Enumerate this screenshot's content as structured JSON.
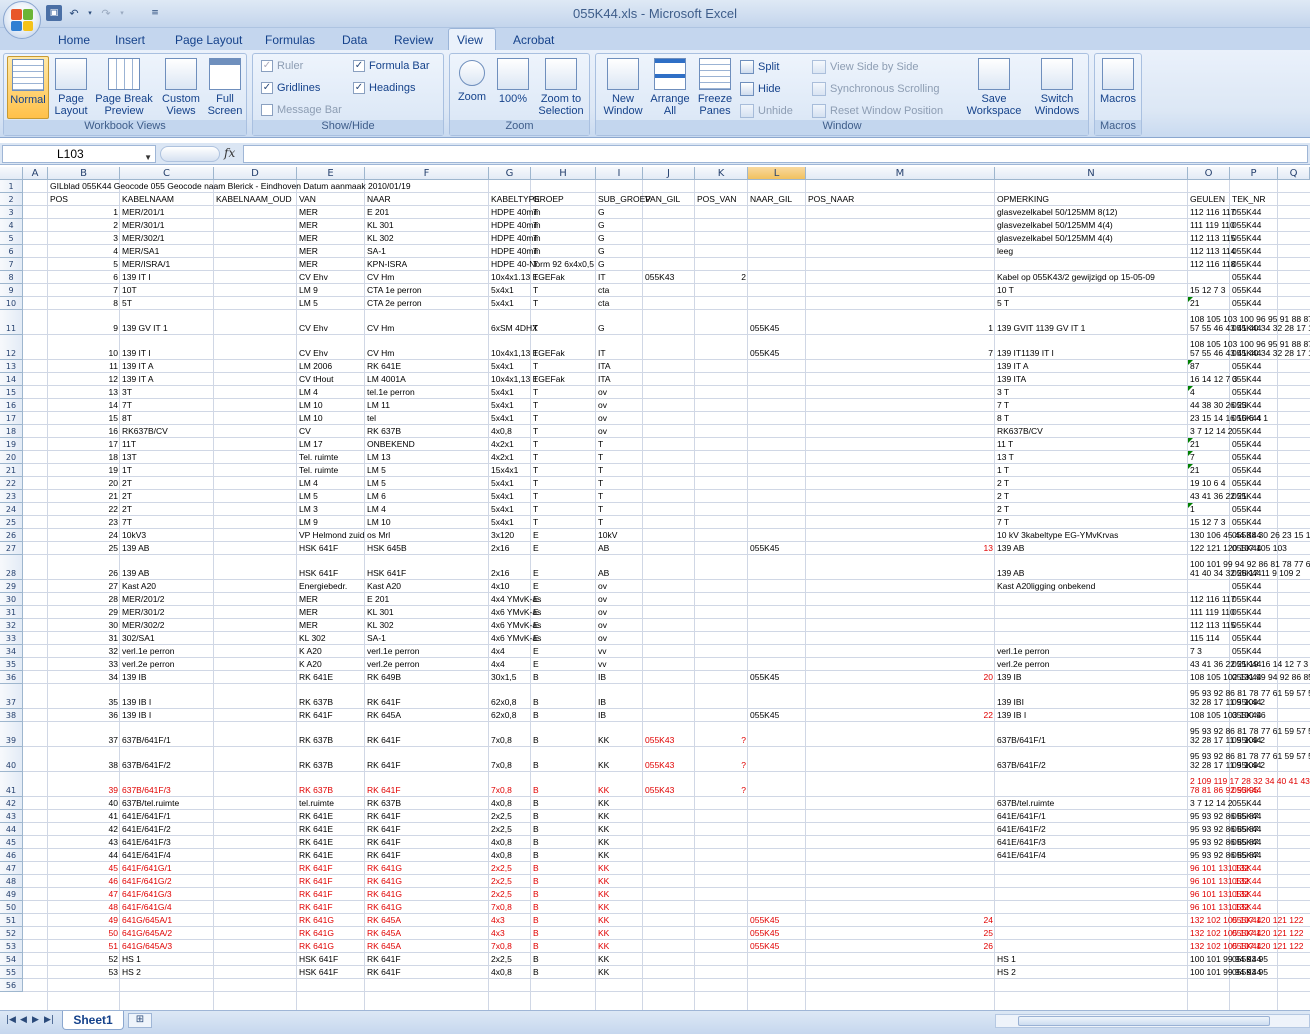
{
  "window": {
    "title": "055K44.xls - Microsoft Excel"
  },
  "qat": {
    "save": "💾",
    "undo": "↶",
    "redo": "↷"
  },
  "tabs": [
    "Home",
    "Insert",
    "Page Layout",
    "Formulas",
    "Data",
    "Review",
    "View",
    "Acrobat"
  ],
  "active_tab": "View",
  "ribbon": {
    "workbook_views": {
      "label": "Workbook Views",
      "normal": "Normal",
      "page_layout": "Page Layout",
      "page_break": "Page Break Preview",
      "custom": "Custom Views",
      "full": "Full Screen"
    },
    "show_hide": {
      "label": "Show/Hide",
      "ruler": "Ruler",
      "gridlines": "Gridlines",
      "message_bar": "Message Bar",
      "formula_bar": "Formula Bar",
      "headings": "Headings"
    },
    "zoom": {
      "label": "Zoom",
      "zoom": "Zoom",
      "hundred": "100%",
      "selection": "Zoom to Selection"
    },
    "window": {
      "label": "Window",
      "new_window": "New Window",
      "arrange": "Arrange All",
      "freeze": "Freeze Panes",
      "split": "Split",
      "hide": "Hide",
      "unhide": "Unhide",
      "side": "View Side by Side",
      "sync": "Synchronous Scrolling",
      "reset": "Reset Window Position",
      "save_ws": "Save Workspace",
      "switch": "Switch Windows"
    },
    "macros": {
      "label": "Macros",
      "macros": "Macros"
    }
  },
  "formula_bar": {
    "name_box": "L103",
    "fx": "fx",
    "value": ""
  },
  "columns": [
    "A",
    "B",
    "C",
    "D",
    "E",
    "F",
    "G",
    "H",
    "I",
    "J",
    "K",
    "L",
    "M",
    "N",
    "O",
    "P",
    "Q"
  ],
  "selected_column": "L",
  "row1": "GILblad 055K44 Geocode 055 Geocode naam Blerick - Eindhoven Datum aanmaak 2010/01/19",
  "headers": [
    "POS",
    "KABELNAAM",
    "KABELNAAM_OUD",
    "VAN",
    "NAAR",
    "KABELTYPE",
    "GROEP",
    "SUB_GROEP",
    "VAN_GIL",
    "POS_VAN",
    "NAAR_GIL",
    "POS_NAAR",
    "OPMERKING",
    "GEULEN",
    "TEK_NR"
  ],
  "rows": [
    {
      "n": 3,
      "c": [
        "1",
        "MER/201/1",
        "",
        "MER",
        "E 201",
        "HDPE 40mm",
        "T",
        "G",
        "",
        "",
        "",
        "",
        "glasvezelkabel 50/125MM 8(12)",
        "112 116 117",
        "055K44"
      ]
    },
    {
      "n": 4,
      "c": [
        "2",
        "MER/301/1",
        "",
        "MER",
        "KL 301",
        "HDPE 40mm",
        "T",
        "G",
        "",
        "",
        "",
        "",
        "glasvezelkabel 50/125MM 4(4)",
        "111 119 110",
        "055K44"
      ]
    },
    {
      "n": 5,
      "c": [
        "3",
        "MER/302/1",
        "",
        "MER",
        "KL 302",
        "HDPE 40mm",
        "T",
        "G",
        "",
        "",
        "",
        "",
        "glasvezelkabel 50/125MM 4(4)",
        "112 113 115",
        "055K44"
      ]
    },
    {
      "n": 6,
      "c": [
        "4",
        "MER/SA1",
        "",
        "MER",
        "SA-1",
        "HDPE 40mm",
        "T",
        "G",
        "",
        "",
        "",
        "",
        "leeg",
        "112 113 114",
        "055K44"
      ]
    },
    {
      "n": 7,
      "c": [
        "5",
        "MER/ISRA/1",
        "",
        "MER",
        "KPN-ISRA",
        "HDPE 40-Norm 92 6x4x0,5",
        "T",
        "G",
        "",
        "",
        "",
        "",
        "",
        "112 116 118",
        "055K44"
      ]
    },
    {
      "n": 8,
      "c": [
        "6",
        "139 IT I",
        "",
        "CV Ehv",
        "CV Hm",
        "10x4x1.13 EGEFak",
        "T",
        "IT",
        "055K43",
        "2",
        "",
        "",
        "Kabel op 055K43/2 gewijzigd op 15-05-09",
        "",
        "055K44"
      ]
    },
    {
      "n": 9,
      "c": [
        "7",
        "10T",
        "",
        "LM 9",
        "CTA 1e perron",
        "5x4x1",
        "T",
        "cta",
        "",
        "",
        "",
        "",
        "10 T",
        "15 12 7 3",
        "055K44"
      ]
    },
    {
      "n": 10,
      "c": [
        "8",
        "5T",
        "",
        "LM 5",
        "CTA 2e perron",
        "5x4x1",
        "T",
        "cta",
        "",
        "",
        "",
        "",
        "5 T",
        "21",
        "055K44"
      ]
    },
    {
      "n": 11,
      "c": [
        "9",
        "139 GV IT 1",
        "",
        "CV Ehv",
        "CV Hm",
        "6xSM 4DHX",
        "T",
        "G",
        "",
        "",
        "055K45",
        "1",
        "139 GVIT 1139 GV IT 1",
        "108 105 103 100 96 95 91 88 87 83 80 78 77 61 59|57 55 46 43 41 40 34 32 28 17 11 9 109 2",
        "055K44"
      ]
    },
    {
      "n": 12,
      "c": [
        "10",
        "139 IT I",
        "",
        "CV Ehv",
        "CV Hm",
        "10x4x1,13 EGEFak",
        "T",
        "IT",
        "",
        "",
        "055K45",
        "7",
        "139 IT1139 IT I",
        "108 105 103 100 96 95 91 88 87 83 80 78 77 61 59|57 55 46 43 41 40 34 32 28 17 11 9 109 2",
        "055K44"
      ]
    },
    {
      "n": 13,
      "c": [
        "11",
        "139 IT A",
        "",
        "LM 2006",
        "RK 641E",
        "5x4x1",
        "T",
        "ITA",
        "",
        "",
        "",
        "",
        "139 IT A",
        "87",
        "055K44"
      ]
    },
    {
      "n": 14,
      "c": [
        "12",
        "139 IT A",
        "",
        "CV tHout",
        "LM 4001A",
        "10x4x1,13 EGEFak",
        "T",
        "ITA",
        "",
        "",
        "",
        "",
        "139 ITA",
        "16 14 12 7 3",
        "055K44"
      ]
    },
    {
      "n": 15,
      "c": [
        "13",
        "3T",
        "",
        "LM 4",
        "tel.1e perron",
        "5x4x1",
        "T",
        "ov",
        "",
        "",
        "",
        "",
        "3 T",
        "4",
        "055K44"
      ]
    },
    {
      "n": 16,
      "c": [
        "14",
        "7T",
        "",
        "LM 10",
        "LM 11",
        "5x4x1",
        "T",
        "ov",
        "",
        "",
        "",
        "",
        "7 T",
        "44 38 30 26 23",
        "055K44"
      ]
    },
    {
      "n": 17,
      "c": [
        "15",
        "8T",
        "",
        "LM 10",
        "tel",
        "5x4x1",
        "T",
        "ov",
        "",
        "",
        "",
        "",
        "8 T",
        "23 15 14 16 10 6 4 1",
        "055K44"
      ]
    },
    {
      "n": 18,
      "c": [
        "16",
        "RK637B/CV",
        "",
        "CV",
        "RK 637B",
        "4x0,8",
        "T",
        "ov",
        "",
        "",
        "",
        "",
        "RK637B/CV",
        "3 7 12 14 2",
        "055K44"
      ]
    },
    {
      "n": 19,
      "c": [
        "17",
        "11T",
        "",
        "LM 17",
        "ONBEKEND",
        "4x2x1",
        "T",
        "T",
        "",
        "",
        "",
        "",
        "11 T",
        "21",
        "055K44"
      ]
    },
    {
      "n": 20,
      "c": [
        "18",
        "13T",
        "",
        "Tel. ruimte",
        "LM 13",
        "4x2x1",
        "T",
        "T",
        "",
        "",
        "",
        "",
        "13 T",
        "7",
        "055K44"
      ]
    },
    {
      "n": 21,
      "c": [
        "19",
        "1T",
        "",
        "Tel. ruimte",
        "LM 5",
        "15x4x1",
        "T",
        "T",
        "",
        "",
        "",
        "",
        "1 T",
        "21",
        "055K44"
      ]
    },
    {
      "n": 22,
      "c": [
        "20",
        "2T",
        "",
        "LM 4",
        "LM 5",
        "5x4x1",
        "T",
        "T",
        "",
        "",
        "",
        "",
        "2 T",
        "19 10 6 4",
        "055K44"
      ]
    },
    {
      "n": 23,
      "c": [
        "21",
        "2T",
        "",
        "LM 5",
        "LM 6",
        "5x4x1",
        "T",
        "T",
        "",
        "",
        "",
        "",
        "2 T",
        "43 41 36 22 21",
        "055K44"
      ]
    },
    {
      "n": 24,
      "c": [
        "22",
        "2T",
        "",
        "LM 3",
        "LM 4",
        "5x4x1",
        "T",
        "T",
        "",
        "",
        "",
        "",
        "2 T",
        "1",
        "055K44"
      ]
    },
    {
      "n": 25,
      "c": [
        "23",
        "7T",
        "",
        "LM 9",
        "LM 10",
        "5x4x1",
        "T",
        "T",
        "",
        "",
        "",
        "",
        "7 T",
        "15 12 7 3",
        "055K44"
      ]
    },
    {
      "n": 26,
      "c": [
        "24",
        "10kV3",
        "",
        "VP Helmond zuid",
        "os Mrl",
        "3x120",
        "E",
        "10kV",
        "",
        "",
        "",
        "",
        "10 kV 3kabeltype EG-YMvKrvas",
        "130 106 45 44 38 30 26 23 15 12 7 3",
        "055K44"
      ]
    },
    {
      "n": 27,
      "c": [
        "25",
        "139 AB",
        "",
        "HSK 641F",
        "HSK 645B",
        "2x16",
        "E",
        "AB",
        "",
        "",
        "055K45",
        "13",
        "139 AB",
        "122 121 120 107 105 103",
        "055K44"
      ]
    },
    {
      "n": 28,
      "c": [
        "26",
        "139 AB",
        "",
        "HSK 641F",
        "HSK 641F",
        "2x16",
        "E",
        "AB",
        "",
        "",
        "",
        "",
        "139 AB",
        "100 101 99 94 92 86 81 78 77 61 59 57 55 46 43|41 40 34 32 28 17 11 9 109 2",
        "055K44"
      ]
    },
    {
      "n": 29,
      "c": [
        "27",
        "Kast A20",
        "",
        "Energiebedr.",
        "Kast A20",
        "4x10",
        "E",
        "ov",
        "",
        "",
        "",
        "",
        "Kast A20ligging onbekend",
        "",
        "055K44"
      ]
    },
    {
      "n": 30,
      "c": [
        "28",
        "MER/201/2",
        "",
        "MER",
        "E 201",
        "4x4 YMvK-as",
        "E",
        "ov",
        "",
        "",
        "",
        "",
        "",
        "112 116 117",
        "055K44"
      ]
    },
    {
      "n": 31,
      "c": [
        "29",
        "MER/301/2",
        "",
        "MER",
        "KL 301",
        "4x6 YMvK-as",
        "E",
        "ov",
        "",
        "",
        "",
        "",
        "",
        "111 119 110",
        "055K44"
      ]
    },
    {
      "n": 32,
      "c": [
        "30",
        "MER/302/2",
        "",
        "MER",
        "KL 302",
        "4x6 YMvK-as",
        "E",
        "ov",
        "",
        "",
        "",
        "",
        "",
        "112 113 115",
        "055K44"
      ]
    },
    {
      "n": 33,
      "c": [
        "31",
        "302/SA1",
        "",
        "KL 302",
        "SA-1",
        "4x6 YMvK-as",
        "E",
        "ov",
        "",
        "",
        "",
        "",
        "",
        "115 114",
        "055K44"
      ]
    },
    {
      "n": 34,
      "c": [
        "32",
        "verl.1e perron",
        "",
        "K A20",
        "verl.1e perron",
        "4x4",
        "E",
        "vv",
        "",
        "",
        "",
        "",
        "verl.1e perron",
        "7 3",
        "055K44"
      ]
    },
    {
      "n": 35,
      "c": [
        "33",
        "verl.2e perron",
        "",
        "K A20",
        "verl.2e perron",
        "4x4",
        "E",
        "vv",
        "",
        "",
        "",
        "",
        "verl.2e perron",
        "43 41 36 22 21 19 16 14 12 7 3",
        "055K44"
      ]
    },
    {
      "n": 36,
      "c": [
        "34",
        "139 IB",
        "",
        "RK 641E",
        "RK 649B",
        "30x1,5",
        "B",
        "IB",
        "",
        "",
        "055K45",
        "20",
        "139 IB",
        "108 105 102 131 99 94 92 86 85 87",
        "055K44"
      ]
    },
    {
      "n": 37,
      "c": [
        "35",
        "139 IB I",
        "",
        "RK 637B",
        "RK 641F",
        "62x0,8",
        "B",
        "IB",
        "",
        "",
        "",
        "",
        "139 IBI",
        "95 93 92 86 81 78 77 61 59 57 55 46 43 41 40 34|32 28 17 11 9 109 2",
        "055K44"
      ]
    },
    {
      "n": 38,
      "c": [
        "36",
        "139 IB I",
        "",
        "RK 641F",
        "RK 645A",
        "62x0,8",
        "B",
        "IB",
        "",
        "",
        "055K45",
        "22",
        "139 IB I",
        "108 105 103 100 96",
        "055K44"
      ]
    },
    {
      "n": 39,
      "c": [
        "37",
        "637B/641F/1",
        "",
        "RK 637B",
        "RK 641F",
        "7x0,8",
        "B",
        "KK",
        "055K43",
        "?",
        "",
        "",
        "637B/641F/1",
        "95 93 92 86 81 78 77 61 59 57 55 46 43 41 40 34|32 28 17 11 9 109 2",
        "055K44"
      ]
    },
    {
      "n": 40,
      "c": [
        "38",
        "637B/641F/2",
        "",
        "RK 637B",
        "RK 641F",
        "7x0,8",
        "B",
        "KK",
        "055K43",
        "?",
        "",
        "",
        "637B/641F/2",
        "95 93 92 86 81 78 77 61 59 57 55 46 43 41 40 34|32 28 17 11 9 109 2",
        "055K44"
      ]
    },
    {
      "n": 41,
      "c": [
        "39",
        "637B/641F/3",
        "",
        "RK 637B",
        "RK 641F",
        "7x0,8",
        "B",
        "KK",
        "055K43",
        "?",
        "",
        "",
        "",
        "2 109 119 17 28 32 34 40 41 43 46 55 57 59 61 77|78 81 86 92 93 95",
        "055K44"
      ]
    },
    {
      "n": 42,
      "c": [
        "40",
        "637B/tel.ruimte",
        "",
        "tel.ruimte",
        "RK 637B",
        "4x0,8",
        "B",
        "KK",
        "",
        "",
        "",
        "",
        "637B/tel.ruimte",
        "3 7 12 14 2",
        "055K44"
      ]
    },
    {
      "n": 43,
      "c": [
        "41",
        "641E/641F/1",
        "",
        "RK 641E",
        "RK 641F",
        "2x2,5",
        "B",
        "KK",
        "",
        "",
        "",
        "",
        "641E/641F/1",
        "95 93 92 86 85 87",
        "055K44"
      ]
    },
    {
      "n": 44,
      "c": [
        "42",
        "641E/641F/2",
        "",
        "RK 641E",
        "RK 641F",
        "2x2,5",
        "B",
        "KK",
        "",
        "",
        "",
        "",
        "641E/641F/2",
        "95 93 92 86 85 87",
        "055K44"
      ]
    },
    {
      "n": 45,
      "c": [
        "43",
        "641E/641F/3",
        "",
        "RK 641E",
        "RK 641F",
        "4x0,8",
        "B",
        "KK",
        "",
        "",
        "",
        "",
        "641E/641F/3",
        "95 93 92 86 85 87",
        "055K44"
      ]
    },
    {
      "n": 46,
      "c": [
        "44",
        "641E/641F/4",
        "",
        "RK 641E",
        "RK 641F",
        "4x0,8",
        "B",
        "KK",
        "",
        "",
        "",
        "",
        "641E/641F/4",
        "95 93 92 86 85 87",
        "055K44"
      ]
    },
    {
      "n": 47,
      "c": [
        "45",
        "641F/641G/1",
        "",
        "RK 641F",
        "RK 641G",
        "2x2,5",
        "B",
        "KK",
        "",
        "",
        "",
        "",
        "",
        "96 101 131 132",
        "055K44"
      ]
    },
    {
      "n": 48,
      "c": [
        "46",
        "641F/641G/2",
        "",
        "RK 641F",
        "RK 641G",
        "2x2,5",
        "B",
        "KK",
        "",
        "",
        "",
        "",
        "",
        "96 101 131 132",
        "055K44"
      ]
    },
    {
      "n": 49,
      "c": [
        "47",
        "641F/641G/3",
        "",
        "RK 641F",
        "RK 641G",
        "2x2,5",
        "B",
        "KK",
        "",
        "",
        "",
        "",
        "",
        "96 101 131 132",
        "055K44"
      ]
    },
    {
      "n": 50,
      "c": [
        "48",
        "641F/641G/4",
        "",
        "RK 641F",
        "RK 641G",
        "7x0,8",
        "B",
        "KK",
        "",
        "",
        "",
        "",
        "",
        "96 101 131 132",
        "055K44"
      ]
    },
    {
      "n": 51,
      "c": [
        "49",
        "641G/645A/1",
        "",
        "RK 641G",
        "RK 645A",
        "4x3",
        "B",
        "KK",
        "",
        "",
        "055K45",
        "24",
        "",
        "132 102 105 107 120 121 122",
        "055K44"
      ]
    },
    {
      "n": 52,
      "c": [
        "50",
        "641G/645A/2",
        "",
        "RK 641G",
        "RK 645A",
        "4x3",
        "B",
        "KK",
        "",
        "",
        "055K45",
        "25",
        "",
        "132 102 105 107 120 121 122",
        "055K44"
      ]
    },
    {
      "n": 53,
      "c": [
        "51",
        "641G/645A/3",
        "",
        "RK 641G",
        "RK 645A",
        "7x0,8",
        "B",
        "KK",
        "",
        "",
        "055K45",
        "26",
        "",
        "132 102 105 107 120 121 122",
        "055K44"
      ]
    },
    {
      "n": 54,
      "c": [
        "52",
        "HS 1",
        "",
        "HSK 641F",
        "RK 641F",
        "2x2,5",
        "B",
        "KK",
        "",
        "",
        "",
        "",
        "HS 1",
        "100 101 99 94 93 95",
        "055K44"
      ]
    },
    {
      "n": 55,
      "c": [
        "53",
        "HS 2",
        "",
        "HSK 641F",
        "RK 641F",
        "4x0,8",
        "B",
        "KK",
        "",
        "",
        "",
        "",
        "HS 2",
        "100 101 99 94 93 95",
        "055K44"
      ]
    }
  ],
  "colors": {
    "red_text": "#e00000",
    "accent": "#ffc14a"
  },
  "sheet": {
    "name": "Sheet1"
  }
}
